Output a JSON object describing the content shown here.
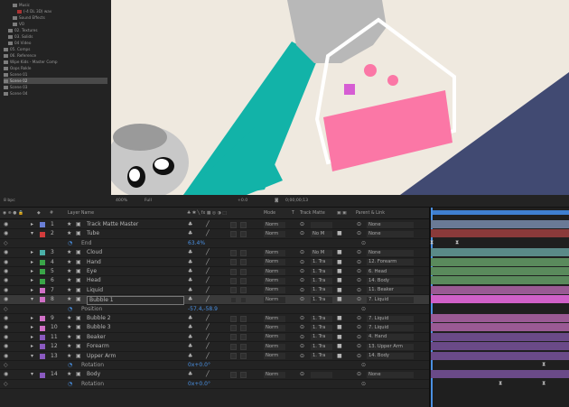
{
  "project": {
    "items": [
      {
        "label": "Music",
        "depth": 2,
        "color": "#7c7c7c"
      },
      {
        "label": "(-4 DL 3D) wav",
        "depth": 3,
        "color": "#a33"
      },
      {
        "label": "Sound Effects",
        "depth": 2,
        "color": "#7c7c7c"
      },
      {
        "label": "VO",
        "depth": 2,
        "color": "#7c7c7c"
      },
      {
        "label": "02. Textures",
        "depth": 1,
        "color": "#7c7c7c"
      },
      {
        "label": "03. Solids",
        "depth": 1,
        "color": "#7c7c7c"
      },
      {
        "label": "04 Video",
        "depth": 1,
        "color": "#7c7c7c"
      },
      {
        "label": "05. Comps",
        "depth": 0,
        "color": "#7c7c7c"
      },
      {
        "label": "06. Reference",
        "depth": 0,
        "color": "#7c7c7c"
      },
      {
        "label": "Wipe Kids - Master Comp",
        "depth": 0,
        "color": "#7c7c7c"
      },
      {
        "label": "Oops Rokle",
        "depth": 0,
        "color": "#7c7c7c"
      },
      {
        "label": "Scene 01",
        "depth": 0,
        "color": "#7c7c7c"
      },
      {
        "label": "Scene 02",
        "depth": 0,
        "color": "#7c7c7c",
        "selected": true
      },
      {
        "label": "Scene 03",
        "depth": 0,
        "color": "#7c7c7c"
      },
      {
        "label": "Scene 04",
        "depth": 0,
        "color": "#7c7c7c"
      }
    ],
    "bpc": "8 bpc"
  },
  "viewer": {
    "zoom": "400%",
    "resolution": "Full",
    "exposure": "+0.0",
    "timecode": "0;00;00;13"
  },
  "timeline": {
    "headers": {
      "num": "#",
      "layer_name": "Layer Name",
      "mode": "Mode",
      "t": "T",
      "track_matte": "Track Matte",
      "parent": "Parent & Link"
    },
    "rows": [
      {
        "kind": "layer",
        "num": "1",
        "name": "Track Matte Master",
        "color": "#6a7fd6",
        "mode": "Norm",
        "matte": "",
        "parent": "None",
        "bar": "#6a7a96",
        "tri": "▸"
      },
      {
        "kind": "layer",
        "num": "2",
        "name": "Tube",
        "color": "#d23c3c",
        "mode": "Norm",
        "matte": "No M",
        "parent": "None",
        "bar": "#8a3a3a",
        "tri": "▾"
      },
      {
        "kind": "prop",
        "name": "End",
        "value": "63.4%",
        "kf": [
          476,
          504
        ]
      },
      {
        "kind": "layer",
        "num": "3",
        "name": "Cloud",
        "color": "#4ab0a8",
        "mode": "Norm",
        "matte": "No M",
        "parent": "None",
        "bar": "#5a8a88",
        "tri": "▸"
      },
      {
        "kind": "layer",
        "num": "4",
        "name": "Hand",
        "color": "#3aa648",
        "mode": "Norm",
        "matte": "1. Tra",
        "parent": "12. Forearm",
        "bar": "#5a8a5c",
        "tri": "▸"
      },
      {
        "kind": "layer",
        "num": "5",
        "name": "Eye",
        "color": "#3aa648",
        "mode": "Norm",
        "matte": "1. Tra",
        "parent": "6. Head",
        "bar": "#5a8a5c",
        "tri": "▸"
      },
      {
        "kind": "layer",
        "num": "6",
        "name": "Head",
        "color": "#3aa648",
        "mode": "Norm",
        "matte": "1. Tra",
        "parent": "14. Body",
        "bar": "#5a8a5c",
        "tri": "▸"
      },
      {
        "kind": "layer",
        "num": "7",
        "name": "Liquid",
        "color": "#d070c6",
        "mode": "Norm",
        "matte": "1. Tra",
        "parent": "11. Beaker",
        "bar": "#9a5a94",
        "tri": "▸"
      },
      {
        "kind": "layer",
        "num": "8",
        "name": "Bubble 1",
        "color": "#d070c6",
        "mode": "Norm",
        "matte": "1. Tra",
        "parent": "7. Liquid",
        "bar": "#d060c8",
        "tri": "▾",
        "selected": true
      },
      {
        "kind": "prop",
        "name": "Position",
        "value": "-57.4,-58.9",
        "kf": []
      },
      {
        "kind": "layer",
        "num": "9",
        "name": "Bubble 2",
        "color": "#d070c6",
        "mode": "Norm",
        "matte": "1. Tra",
        "parent": "7. Liquid",
        "bar": "#9a5a94",
        "tri": "▸"
      },
      {
        "kind": "layer",
        "num": "10",
        "name": "Bubble 3",
        "color": "#d070c6",
        "mode": "Norm",
        "matte": "1. Tra",
        "parent": "7. Liquid",
        "bar": "#9a5a94",
        "tri": "▸"
      },
      {
        "kind": "layer",
        "num": "11",
        "name": "Beaker",
        "color": "#8a5ac0",
        "mode": "Norm",
        "matte": "1. Tra",
        "parent": "4. Hand",
        "bar": "#6a4a88",
        "tri": "▸"
      },
      {
        "kind": "layer",
        "num": "12",
        "name": "Forearm",
        "color": "#8a5ac0",
        "mode": "Norm",
        "matte": "1. Tra",
        "parent": "13. Upper Arm",
        "bar": "#6a4a88",
        "tri": "▸"
      },
      {
        "kind": "layer",
        "num": "13",
        "name": "Upper Arm",
        "color": "#8a5ac0",
        "mode": "Norm",
        "matte": "1. Tra",
        "parent": "14. Body",
        "bar": "#6a4a88",
        "tri": "▾"
      },
      {
        "kind": "prop",
        "name": "Rotation",
        "value": "0x+0.0°",
        "kf": [
          600
        ]
      },
      {
        "kind": "layer",
        "num": "14",
        "name": "Body",
        "color": "#8a5ac0",
        "mode": "Norm",
        "matte": "",
        "parent": "None",
        "bar": "#6a4a88",
        "tri": "▾"
      },
      {
        "kind": "prop",
        "name": "Rotation",
        "value": "0x+0.0°",
        "kf": [
          552,
          600
        ]
      }
    ]
  }
}
